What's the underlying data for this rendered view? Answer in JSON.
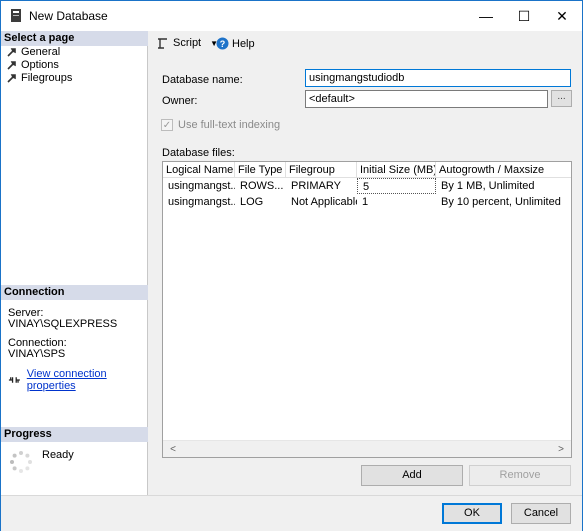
{
  "window": {
    "title": "New Database",
    "minimize_label": "—",
    "maximize_label": "☐",
    "close_label": "✕"
  },
  "sidebar": {
    "select_page_header": "Select a page",
    "pages": [
      {
        "label": "General"
      },
      {
        "label": "Options"
      },
      {
        "label": "Filegroups"
      }
    ],
    "connection_header": "Connection",
    "server_label": "Server:",
    "server_value": "VINAY\\SQLEXPRESS",
    "connection_label": "Connection:",
    "connection_value": "VINAY\\SPS",
    "view_connection_link": "View connection properties",
    "progress_header": "Progress",
    "progress_status": "Ready"
  },
  "toolbar": {
    "script_label": "Script",
    "help_label": "Help"
  },
  "form": {
    "database_name_label": "Database name:",
    "database_name_value": "usingmangstudiodb",
    "owner_label": "Owner:",
    "owner_value": "<default>",
    "browse_label": "...",
    "fulltext_label": "Use full-text indexing",
    "database_files_label": "Database files:"
  },
  "grid": {
    "columns": [
      "Logical Name",
      "File Type",
      "Filegroup",
      "Initial Size (MB)",
      "Autogrowth / Maxsize"
    ],
    "rows": [
      {
        "logical_name": "usingmangst...",
        "file_type": "ROWS...",
        "filegroup": "PRIMARY",
        "initial_size": "5",
        "autogrowth": "By 1 MB, Unlimited"
      },
      {
        "logical_name": "usingmangst...",
        "file_type": "LOG",
        "filegroup": "Not Applicable",
        "initial_size": "1",
        "autogrowth": "By 10 percent, Unlimited"
      }
    ],
    "scroll_left": "<",
    "scroll_right": ">"
  },
  "buttons": {
    "add": "Add",
    "remove": "Remove",
    "ok": "OK",
    "cancel": "Cancel"
  },
  "colors": {
    "section_header_bg": "#d6dbe9",
    "link": "#0033cc",
    "accent_border": "#0078d7"
  }
}
